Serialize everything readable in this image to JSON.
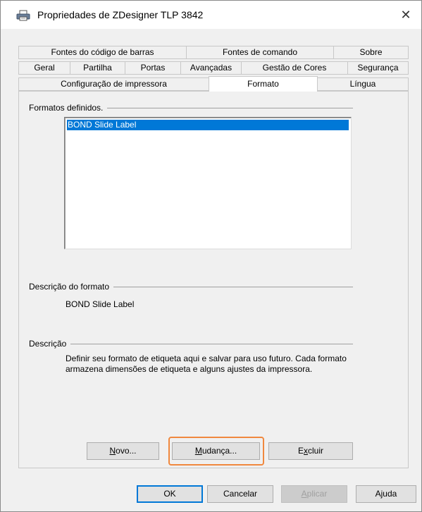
{
  "window": {
    "title": "Propriedades de ZDesigner TLP 3842",
    "close_glyph": "✕"
  },
  "tabs": {
    "row1": [
      "Fontes do código de barras",
      "Fontes de comando",
      "Sobre"
    ],
    "row2": [
      "Geral",
      "Partilha",
      "Portas",
      "Avançadas",
      "Gestão de Cores",
      "Segurança"
    ],
    "row3": [
      "Configuração de impressora",
      "Formato",
      "Língua"
    ],
    "active": "Formato"
  },
  "formats": {
    "group_label": "Formatos definidos.",
    "items": [
      "BOND Slide Label"
    ],
    "selected": "BOND Slide Label"
  },
  "format_description": {
    "group_label": "Descrição do formato",
    "value": "BOND Slide Label"
  },
  "description": {
    "group_label": "Descrição",
    "text": "Definir seu formato de etiqueta aqui e salvar para uso futuro. Cada formato armazena dimensões de etiqueta e alguns ajustes da impressora."
  },
  "panel_buttons": {
    "new": {
      "pre": "",
      "ul": "N",
      "post": "ovo..."
    },
    "change": {
      "pre": "",
      "ul": "M",
      "post": "udança..."
    },
    "delete": {
      "pre": "E",
      "ul": "x",
      "post": "cluir"
    }
  },
  "dialog_buttons": {
    "ok": "OK",
    "cancel": "Cancelar",
    "apply": {
      "pre": "",
      "ul": "A",
      "post": "plicar"
    },
    "help": "Ajuda"
  },
  "colors": {
    "selection": "#0078d7",
    "highlight_ring": "#f0883e"
  }
}
